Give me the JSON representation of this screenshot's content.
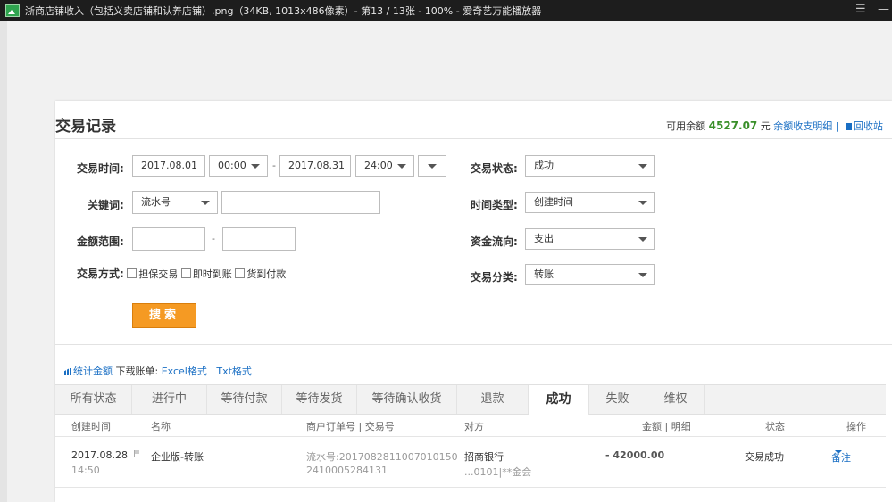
{
  "window": {
    "title": "浙商店铺收入（包括义卖店铺和认养店铺）.png（34KB, 1013x486像素）- 第13 / 13张 - 100% - 爱奇艺万能播放器",
    "menu_glyph": "☰",
    "minimize_glyph": "—"
  },
  "page": {
    "title": "交易记录",
    "balance_label": "可用余额",
    "balance_amount": "4527.07",
    "balance_unit": "元",
    "balance_detail_link": "余额收支明细",
    "separator": "|",
    "recycle_link": "回收站"
  },
  "filters": {
    "time_label": "交易时间:",
    "start_date": "2017.08.01",
    "start_time": "00:00",
    "range_dash": "-",
    "end_date": "2017.08.31",
    "end_time": "24:00",
    "keyword_label": "关键词:",
    "keyword_type": "流水号",
    "keyword_value": "",
    "amount_label": "金额范围:",
    "amount_min": "",
    "amount_max": "",
    "method_label": "交易方式:",
    "method_options": [
      "担保交易",
      "即时到账",
      "货到付款"
    ],
    "status_label": "交易状态:",
    "status_value": "成功",
    "time_type_label": "时间类型:",
    "time_type_value": "创建时间",
    "flow_label": "资金流向:",
    "flow_value": "支出",
    "category_label": "交易分类:",
    "category_value": "转账",
    "search_button": "搜索"
  },
  "stats": {
    "stats_link": "统计金额",
    "download_label": "下载账单:",
    "excel_link": "Excel格式",
    "txt_link": "Txt格式"
  },
  "tabs": [
    "所有状态",
    "进行中",
    "等待付款",
    "等待发货",
    "等待确认收货",
    "退款",
    "成功",
    "失败",
    "维权"
  ],
  "active_tab": "成功",
  "table": {
    "headers": {
      "created": "创建时间",
      "name": "名称",
      "order": "商户订单号 | 交易号",
      "party": "对方",
      "amount": "金额 | 明细",
      "status": "状态",
      "action": "操作"
    },
    "rows": [
      {
        "date": "2017.08.28",
        "time": "14:50",
        "name": "企业版-转账",
        "serial_line1": "流水号:2017082811007010150",
        "serial_line2": "2410005284131",
        "party_name": "招商银行",
        "party_account": "...0101|**金会",
        "amount": "- 42000.00",
        "status": "交易成功",
        "action": "备注"
      }
    ]
  }
}
